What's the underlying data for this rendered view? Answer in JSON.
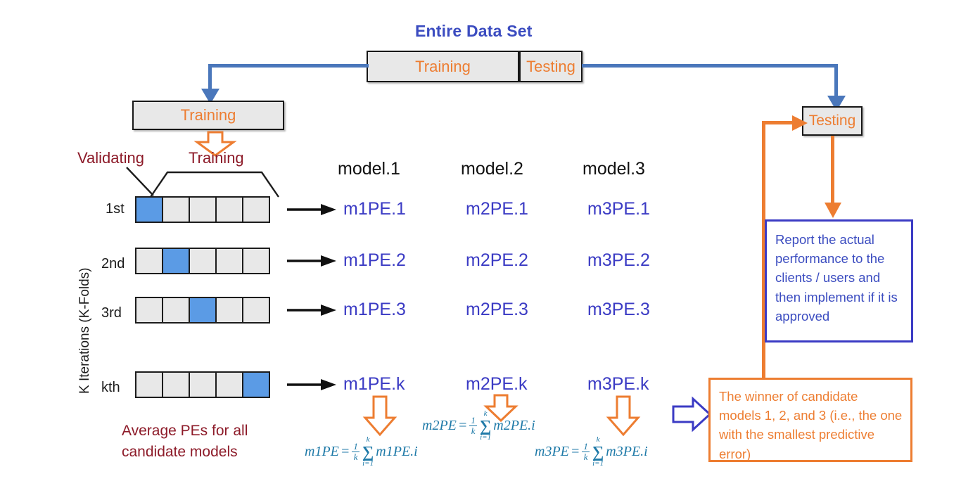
{
  "diagram": {
    "title": "Entire Data Set",
    "top_split": {
      "training_label": "Training",
      "testing_label": "Testing"
    },
    "left_branch": {
      "training_box_label": "Training",
      "validating_label": "Validating",
      "training_label": "Training",
      "axis_caption": "K Iterations (K-Folds)",
      "average_note": "Average PEs for all candidate models"
    },
    "folds": [
      {
        "label": "1st",
        "validation_index": 0,
        "cells": 5
      },
      {
        "label": "2nd",
        "validation_index": 1,
        "cells": 5
      },
      {
        "label": "3rd",
        "validation_index": 2,
        "cells": 5
      },
      {
        "label": "kth",
        "validation_index": 4,
        "cells": 5
      }
    ],
    "models": [
      {
        "header": "model.1",
        "pe_values": [
          "m1PE.1",
          "m1PE.2",
          "m1PE.3",
          "m1PE.k"
        ],
        "formula": {
          "lhs": "m1PE",
          "eq": "=",
          "frac_num": "1",
          "frac_den": "k",
          "sum_top": "k",
          "sum_sign": "∑",
          "sum_bottom": "i=1",
          "term": "m1PE.i"
        }
      },
      {
        "header": "model.2",
        "pe_values": [
          "m2PE.1",
          "m2PE.2",
          "m2PE.3",
          "m2PE.k"
        ],
        "formula": {
          "lhs": "m2PE",
          "eq": "=",
          "frac_num": "1",
          "frac_den": "k",
          "sum_top": "k",
          "sum_sign": "∑",
          "sum_bottom": "i=1",
          "term": "m2PE.i"
        }
      },
      {
        "header": "model.3",
        "pe_values": [
          "m3PE.1",
          "m3PE.2",
          "m3PE.3",
          "m3PE.k"
        ],
        "formula": {
          "lhs": "m3PE",
          "eq": "=",
          "frac_num": "1",
          "frac_den": "k",
          "sum_top": "k",
          "sum_sign": "∑",
          "sum_bottom": "i=1",
          "term": "m3PE.i"
        }
      }
    ],
    "right_branch": {
      "testing_box_label": "Testing",
      "report_box": "Report the actual performance to the clients / users and then implement if it is approved",
      "winner_box": "The winner of candidate models 1, 2, and 3 (i.e., the one with the smallest predictive error)"
    },
    "colors": {
      "blue_accent": "#3b4cc0",
      "orange_accent": "#ed7d31",
      "dark_red": "#8d1b29",
      "validation_cell": "#5b9be5",
      "grey_box": "#e8e8e8",
      "connector_blue": "#4a77bb",
      "formula_teal": "#1f7aa8"
    }
  }
}
